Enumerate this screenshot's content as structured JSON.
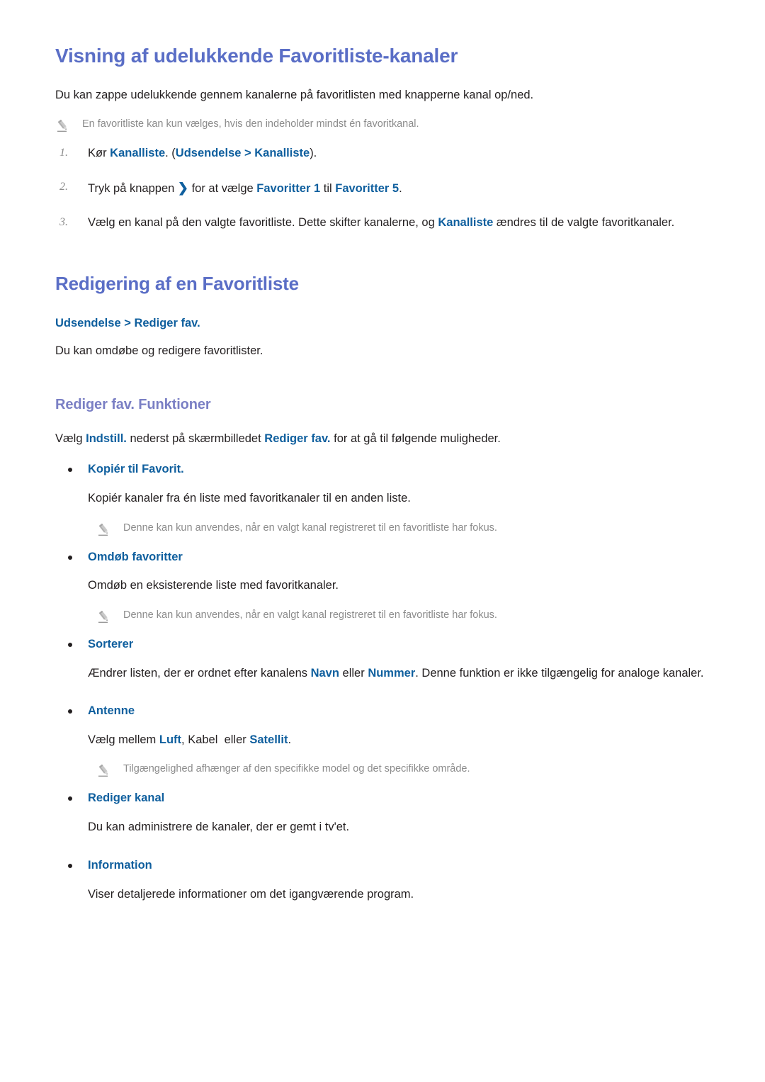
{
  "section1": {
    "heading": "Visning af udelukkende Favoritliste-kanaler",
    "intro": "Du kan zappe udelukkende gennem kanalerne på favoritlisten med knapperne kanal op/ned.",
    "note": "En favoritliste kan kun vælges, hvis den indeholder mindst én favoritkanal.",
    "note_icon": "pencil-icon",
    "steps": [
      {
        "number": "1.",
        "parts": [
          {
            "text": "Kør ",
            "style": "plain"
          },
          {
            "text": "Kanalliste",
            "style": "emphasis"
          },
          {
            "text": ". (",
            "style": "plain"
          },
          {
            "text": "Udsendelse",
            "style": "emphasis"
          },
          {
            "text": " > ",
            "style": "emphasis"
          },
          {
            "text": "Kanalliste",
            "style": "emphasis"
          },
          {
            "text": ").",
            "style": "plain"
          }
        ]
      },
      {
        "number": "2.",
        "parts": [
          {
            "text": "Tryk på knappen ",
            "style": "plain"
          },
          {
            "text": "❯",
            "style": "chevron"
          },
          {
            "text": " for at vælge ",
            "style": "plain"
          },
          {
            "text": "Favoritter 1",
            "style": "emphasis"
          },
          {
            "text": " til ",
            "style": "plain"
          },
          {
            "text": "Favoritter 5",
            "style": "emphasis"
          },
          {
            "text": ".",
            "style": "plain"
          }
        ]
      },
      {
        "number": "3.",
        "parts": [
          {
            "text": "Vælg en kanal på den valgte favoritliste. Dette skifter kanalerne, og ",
            "style": "plain"
          },
          {
            "text": "Kanalliste",
            "style": "emphasis"
          },
          {
            "text": " ændres til de valgte favoritkanaler.",
            "style": "plain"
          }
        ]
      }
    ]
  },
  "section2": {
    "heading": "Redigering af en Favoritliste",
    "menu_path_parts": [
      {
        "text": "Udsendelse",
        "style": "emphasis"
      },
      {
        "text": " > ",
        "style": "emphasis"
      },
      {
        "text": "Rediger fav.",
        "style": "emphasis"
      }
    ],
    "intro": "Du kan omdøbe og redigere favoritlister.",
    "subheading": "Rediger fav. Funktioner",
    "lead_parts": [
      {
        "text": "Vælg ",
        "style": "plain"
      },
      {
        "text": "Indstill.",
        "style": "emphasis"
      },
      {
        "text": " nederst på skærmbilledet ",
        "style": "plain"
      },
      {
        "text": "Rediger fav.",
        "style": "emphasis"
      },
      {
        "text": " for at gå til følgende muligheder.",
        "style": "plain"
      }
    ],
    "options": [
      {
        "title": "Kopiér til Favorit.",
        "desc_parts": [
          {
            "text": "Kopiér kanaler fra én liste med favoritkanaler til en anden liste.",
            "style": "plain"
          }
        ],
        "note": "Denne kan kun anvendes, når en valgt kanal registreret til en favoritliste har fokus.",
        "note_icon": "pencil-icon"
      },
      {
        "title": "Omdøb favoritter",
        "desc_parts": [
          {
            "text": "Omdøb en eksisterende liste med favoritkanaler.",
            "style": "plain"
          }
        ],
        "note": "Denne kan kun anvendes, når en valgt kanal registreret til en favoritliste har fokus.",
        "note_icon": "pencil-icon"
      },
      {
        "title": "Sorterer",
        "desc_parts": [
          {
            "text": "Ændrer listen, der er ordnet efter kanalens ",
            "style": "plain"
          },
          {
            "text": "Navn",
            "style": "emphasis"
          },
          {
            "text": " eller ",
            "style": "plain"
          },
          {
            "text": "Nummer",
            "style": "emphasis"
          },
          {
            "text": ". Denne funktion er ikke tilgængelig for analoge kanaler.",
            "style": "plain"
          }
        ],
        "note": null,
        "note_icon": null
      },
      {
        "title": "Antenne",
        "desc_parts": [
          {
            "text": "Vælg mellem ",
            "style": "plain"
          },
          {
            "text": "Luft",
            "style": "emphasis"
          },
          {
            "text": ", Kabel  eller ",
            "style": "plain"
          },
          {
            "text": "Satellit",
            "style": "emphasis"
          },
          {
            "text": ".",
            "style": "plain"
          }
        ],
        "note": "Tilgængelighed afhænger af den specifikke model og det specifikke område.",
        "note_icon": "pencil-icon"
      },
      {
        "title": "Rediger kanal",
        "desc_parts": [
          {
            "text": "Du kan administrere de kanaler, der er gemt i tv'et.",
            "style": "plain"
          }
        ],
        "note": null,
        "note_icon": null
      },
      {
        "title": "Information",
        "desc_parts": [
          {
            "text": "Viser detaljerede informationer om det igangværende program.",
            "style": "plain"
          }
        ],
        "note": null,
        "note_icon": null
      }
    ]
  },
  "colors": {
    "heading_purple": "#5a6ec6",
    "subheading_purple": "#7a7fc4",
    "emphasis_blue": "#0f5f9e",
    "body_black": "#231f20",
    "note_grey": "#8b8b8b",
    "page_background": "#ffffff"
  }
}
